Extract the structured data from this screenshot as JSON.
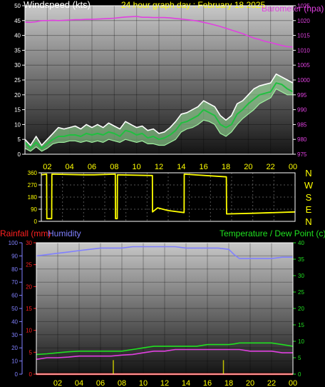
{
  "header": {
    "left_title": "Windspeed (kts)",
    "center_title": "24 hour graph day : February 18 2025",
    "right_title": "Barometer (hpa)"
  },
  "colors": {
    "background": "#000000",
    "frame": "#ffffff",
    "title_white": "#ffffff",
    "title_yellow": "#ffff00",
    "barometer": "#e040e0",
    "gust": "#ffffff",
    "wind_avg": "#20c040",
    "wind_band": "#a0f0a0",
    "direction": "#ffff00",
    "rain": "#ff2020",
    "humidity": "#8080ff",
    "temperature": "#20e020",
    "dewpoint": "#e040e0",
    "rain_rate": "#c0c000",
    "tick_label": "#ffff00"
  },
  "chart_data": [
    {
      "type": "line",
      "title": "24 hour graph day : February 18 2025",
      "x": [
        0,
        0.5,
        1,
        1.5,
        2,
        2.5,
        3,
        3.5,
        4,
        4.5,
        5,
        5.5,
        6,
        6.5,
        7,
        7.5,
        8,
        8.5,
        9,
        9.5,
        10,
        10.5,
        11,
        11.5,
        12,
        12.5,
        13,
        13.5,
        14,
        14.5,
        15,
        15.5,
        16,
        16.5,
        17,
        17.5,
        18,
        18.5,
        19,
        19.5,
        20,
        20.5,
        21,
        21.5,
        22,
        22.5,
        23,
        23.5,
        24
      ],
      "xtick_labels": [
        "02",
        "04",
        "06",
        "08",
        "10",
        "12",
        "14",
        "16",
        "18",
        "20",
        "22",
        "00"
      ],
      "xlim": [
        0,
        24
      ],
      "ylabel_left": "Windspeed (kts)",
      "ylim_left": [
        0,
        50
      ],
      "yticks_left": [
        0,
        5,
        10,
        15,
        20,
        25,
        30,
        35,
        40,
        45,
        50
      ],
      "ylabel_right": "Barometer (hpa)",
      "ylim_right": [
        975,
        1025
      ],
      "yticks_right": [
        975,
        980,
        985,
        990,
        995,
        1000,
        1005,
        1010,
        1015,
        1020,
        1025
      ],
      "series": [
        {
          "axis": "right",
          "values": [
            1019.5,
            1019.4,
            1019.6,
            1020.0,
            1020.0,
            1020.1,
            1020.0,
            1020.1,
            1020.2,
            1020.3,
            1020.3,
            1020.4,
            1020.4,
            1020.5,
            1020.6,
            1020.7,
            1020.8,
            1021.0,
            1021.2,
            1021.3,
            1021.4,
            1021.1,
            1021.1,
            1021.0,
            1021.0,
            1021.0,
            1020.9,
            1020.7,
            1020.5,
            1020.3,
            1020.1,
            1019.8,
            1019.4,
            1019.0,
            1018.5,
            1018.0,
            1017.4,
            1016.8,
            1016.2,
            1015.6,
            1014.8,
            1014.1,
            1013.6,
            1013.0,
            1012.6,
            1012.1,
            1011.6,
            1011.2,
            1011.1
          ]
        },
        {
          "axis": "left",
          "values": [
            5.0,
            3.0,
            6.0,
            3.0,
            5.0,
            7.0,
            9.0,
            8.5,
            9.0,
            9.5,
            8.5,
            10.0,
            9.0,
            10.0,
            9.0,
            10.5,
            9.5,
            8.5,
            11.0,
            10.0,
            9.0,
            9.5,
            8.0,
            8.5,
            7.0,
            7.5,
            9.0,
            11.0,
            13.5,
            14.0,
            15.0,
            16.0,
            18.0,
            17.0,
            16.0,
            13.0,
            11.5,
            13.0,
            17.0,
            18.0,
            20.0,
            22.0,
            23.0,
            23.5,
            24.0,
            27.0,
            26.0,
            25.0,
            24.0
          ]
        },
        {
          "axis": "left",
          "values": [
            2.0,
            1.0,
            2.5,
            1.0,
            2.0,
            3.5,
            4.0,
            4.0,
            4.5,
            4.5,
            4.0,
            4.5,
            4.0,
            4.5,
            4.0,
            5.0,
            4.5,
            4.0,
            5.0,
            4.5,
            4.0,
            4.5,
            3.5,
            3.5,
            3.0,
            3.0,
            4.0,
            5.0,
            7.5,
            8.5,
            9.0,
            10.0,
            11.5,
            11.0,
            10.0,
            7.0,
            6.0,
            7.5,
            10.0,
            12.0,
            13.5,
            15.0,
            17.0,
            18.0,
            19.0,
            22.0,
            21.0,
            20.0,
            20.0
          ]
        },
        {
          "axis": "left",
          "values": [
            4.0,
            2.0,
            4.0,
            2.0,
            3.5,
            5.0,
            6.0,
            6.0,
            6.5,
            6.5,
            6.0,
            7.0,
            6.5,
            7.0,
            6.5,
            7.5,
            7.0,
            6.0,
            8.0,
            7.5,
            6.5,
            7.0,
            5.5,
            6.0,
            5.0,
            5.5,
            6.5,
            8.0,
            10.5,
            11.0,
            12.0,
            13.0,
            15.0,
            14.0,
            13.0,
            10.0,
            9.0,
            10.0,
            13.5,
            15.0,
            17.0,
            18.5,
            20.0,
            20.5,
            21.0,
            24.0,
            23.5,
            22.0,
            21.0
          ]
        }
      ]
    },
    {
      "type": "line",
      "xlim": [
        0,
        24
      ],
      "ylim": [
        0,
        360
      ],
      "yticks": [
        0,
        90,
        180,
        270,
        360
      ],
      "compass_labels": [
        "N",
        "W",
        "S",
        "E",
        "N"
      ],
      "x": [
        0,
        0.5,
        0.52,
        0.98,
        1.0,
        4.0,
        5.0,
        7.0,
        7.02,
        7.18,
        7.2,
        10.5,
        10.52,
        11.0,
        12.0,
        13.5,
        13.52,
        17.5,
        17.52,
        20.0,
        24.0
      ],
      "series": [
        {
          "values": [
            345,
            350,
            20,
            20,
            350,
            345,
            345,
            350,
            20,
            20,
            345,
            340,
            70,
            100,
            80,
            65,
            350,
            330,
            55,
            60,
            70
          ]
        }
      ]
    },
    {
      "type": "line",
      "xlim": [
        0,
        24
      ],
      "x": [
        0,
        1,
        2,
        3,
        4,
        5,
        6,
        7,
        8,
        9,
        10,
        11,
        12,
        13,
        14,
        15,
        16,
        17,
        18,
        18.5,
        19,
        20,
        21,
        22,
        23,
        24
      ],
      "ylabel_left_outer": "Rainfall (mm)",
      "ylim_left_outer": [
        0,
        30
      ],
      "yticks_left_outer": [
        0,
        5,
        10,
        15,
        20,
        25,
        30
      ],
      "ylabel_left_inner": "Humidity",
      "ylim_left_inner": [
        0,
        100
      ],
      "yticks_left_inner": [
        0,
        10,
        20,
        30,
        40,
        50,
        60,
        70,
        80,
        90,
        100
      ],
      "ylabel_right": "Temperature / Dew Point (c)",
      "ylim_right": [
        0,
        40
      ],
      "yticks_right": [
        0,
        5,
        10,
        15,
        20,
        25,
        30,
        35,
        40
      ],
      "series": [
        {
          "axis": "left_inner",
          "values": [
            90,
            91,
            92,
            93,
            94,
            95,
            96,
            96,
            96,
            97,
            97,
            97,
            97,
            97,
            96,
            96,
            96,
            96,
            95,
            91,
            88,
            88,
            88,
            88,
            89,
            89
          ]
        },
        {
          "axis": "right",
          "values": [
            6.0,
            6.2,
            6.5,
            6.8,
            7.0,
            7.0,
            7.0,
            7.0,
            7.0,
            7.5,
            8.0,
            8.5,
            8.5,
            8.5,
            8.5,
            8.5,
            9.0,
            9.0,
            9.0,
            9.2,
            9.5,
            9.5,
            9.5,
            9.5,
            9.0,
            8.5
          ]
        },
        {
          "axis": "right",
          "values": [
            4.5,
            5.0,
            5.0,
            5.2,
            5.5,
            5.5,
            5.5,
            5.5,
            5.8,
            6.0,
            6.5,
            7.0,
            7.0,
            7.5,
            7.5,
            7.5,
            7.5,
            7.5,
            7.5,
            7.5,
            7.5,
            7.0,
            7.0,
            7.0,
            6.5,
            6.5
          ]
        },
        {
          "axis": "left_outer",
          "values": [
            0,
            0,
            0,
            0,
            0,
            0,
            0,
            0,
            0,
            0,
            0,
            0,
            0,
            0,
            0,
            0,
            0,
            0,
            0,
            0,
            0,
            0,
            0,
            0,
            0,
            0
          ]
        }
      ],
      "rain_rate_spikes_x": [
        7.2,
        17.5
      ],
      "rain_rate_spikes_mm": [
        3.2,
        3.2
      ]
    }
  ]
}
